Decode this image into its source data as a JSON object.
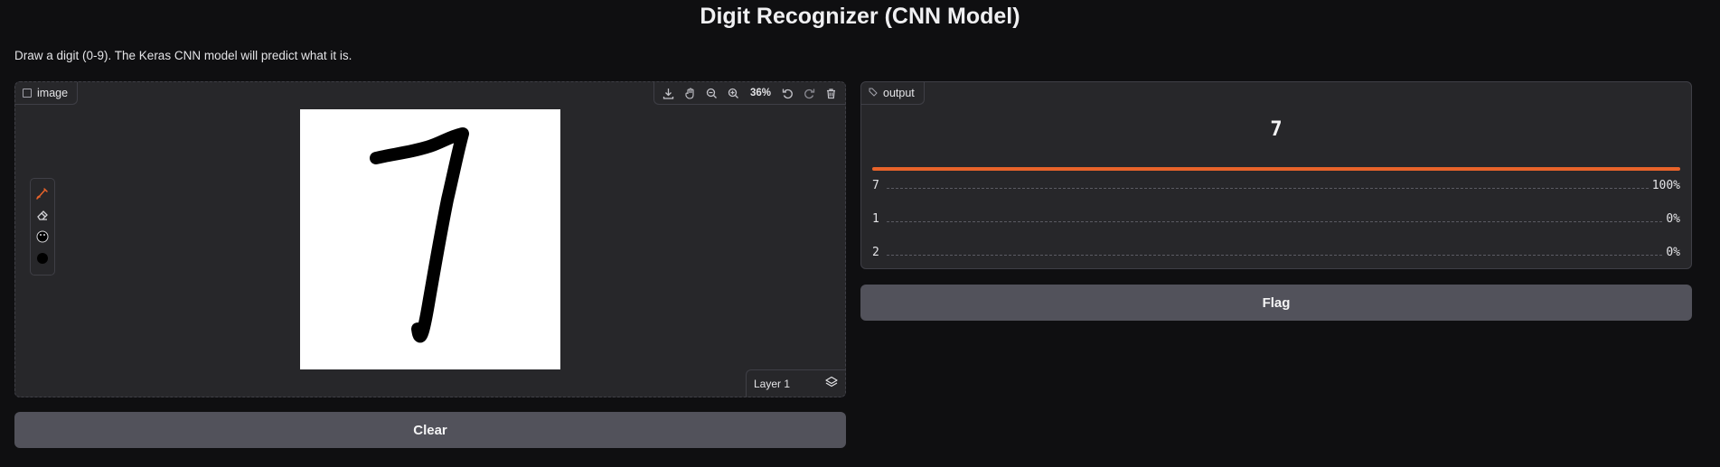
{
  "header": {
    "title": "Digit Recognizer (CNN Model)",
    "description": "Draw a digit (0-9). The Keras CNN model will predict what it is."
  },
  "input_panel": {
    "label": "image",
    "zoom": "36%",
    "layer_label": "Layer 1",
    "icons": [
      "download-icon",
      "pan-icon",
      "zoom-out-icon",
      "zoom-in-icon",
      "undo-icon",
      "redo-icon",
      "trash-icon"
    ],
    "tools": [
      "brush-icon",
      "eraser-icon",
      "color-palette-icon",
      "brush-size-icon"
    ]
  },
  "output_panel": {
    "label": "output",
    "prediction": "7",
    "confidences": [
      {
        "label": "7",
        "value": "100%"
      },
      {
        "label": "1",
        "value": "0%"
      },
      {
        "label": "2",
        "value": "0%"
      }
    ]
  },
  "buttons": {
    "clear": "Clear",
    "flag": "Flag"
  },
  "colors": {
    "accent": "#e8632a",
    "background": "#0f0f11",
    "panel": "#27272a",
    "button": "#52525b"
  }
}
